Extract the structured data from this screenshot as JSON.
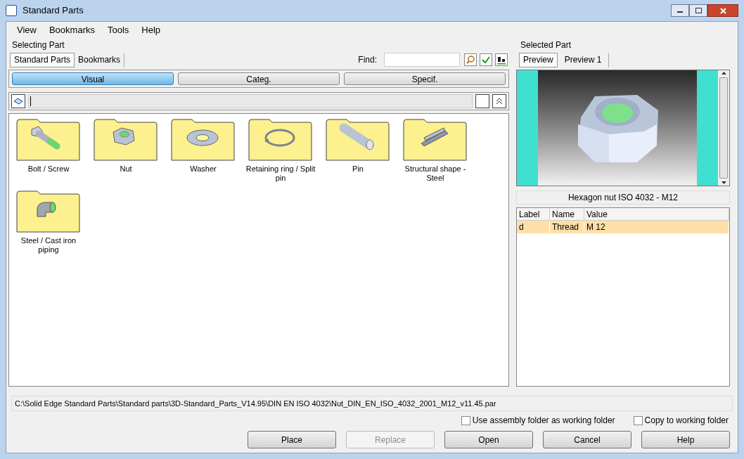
{
  "window": {
    "title": "Standard Parts"
  },
  "menu": [
    "View",
    "Bookmarks",
    "Tools",
    "Help"
  ],
  "selecting": {
    "title": "Selecting Part",
    "tabs": [
      {
        "label": "Standard Parts",
        "selected": true
      },
      {
        "label": "Bookmarks",
        "selected": false
      }
    ],
    "find": {
      "label": "Find:"
    },
    "modes": [
      {
        "label": "Visual",
        "selected": true
      },
      {
        "label": "Categ.",
        "selected": false
      },
      {
        "label": "Specif.",
        "selected": false
      }
    ],
    "categories": [
      {
        "label": "Bolt / Screw",
        "kind": "bolt"
      },
      {
        "label": "Nut",
        "kind": "nut"
      },
      {
        "label": "Washer",
        "kind": "washer"
      },
      {
        "label": "Retaining ring / Split pin",
        "kind": "ring"
      },
      {
        "label": "Pin",
        "kind": "pin"
      },
      {
        "label": "Structural shape - Steel",
        "kind": "beam"
      },
      {
        "label": "Steel / Cast iron piping",
        "kind": "elbow"
      }
    ]
  },
  "selected": {
    "title": "Selected Part",
    "tabs": [
      {
        "label": "Preview",
        "selected": true
      },
      {
        "label": "Preview 1",
        "selected": false
      }
    ],
    "part_name": "Hexagon nut ISO 4032 - M12",
    "table": {
      "columns": [
        "Label",
        "Name",
        "Value"
      ],
      "rows": [
        {
          "cells": [
            "d",
            "Thread",
            "M 12"
          ],
          "selected": true
        }
      ]
    }
  },
  "path": "C:\\Solid Edge Standard Parts\\Standard parts\\3D-Standard_Parts_V14.95\\DIN EN ISO 4032\\Nut_DIN_EN_ISO_4032_2001_M12_v11.45.par",
  "options": [
    {
      "label": "Use assembly folder as working folder",
      "checked": false
    },
    {
      "label": "Copy to working folder",
      "checked": false
    }
  ],
  "buttons": [
    {
      "label": "Place",
      "disabled": false
    },
    {
      "label": "Replace",
      "disabled": true
    },
    {
      "label": "Open",
      "disabled": false
    },
    {
      "label": "Cancel",
      "disabled": false
    },
    {
      "label": "Help",
      "disabled": false
    }
  ]
}
